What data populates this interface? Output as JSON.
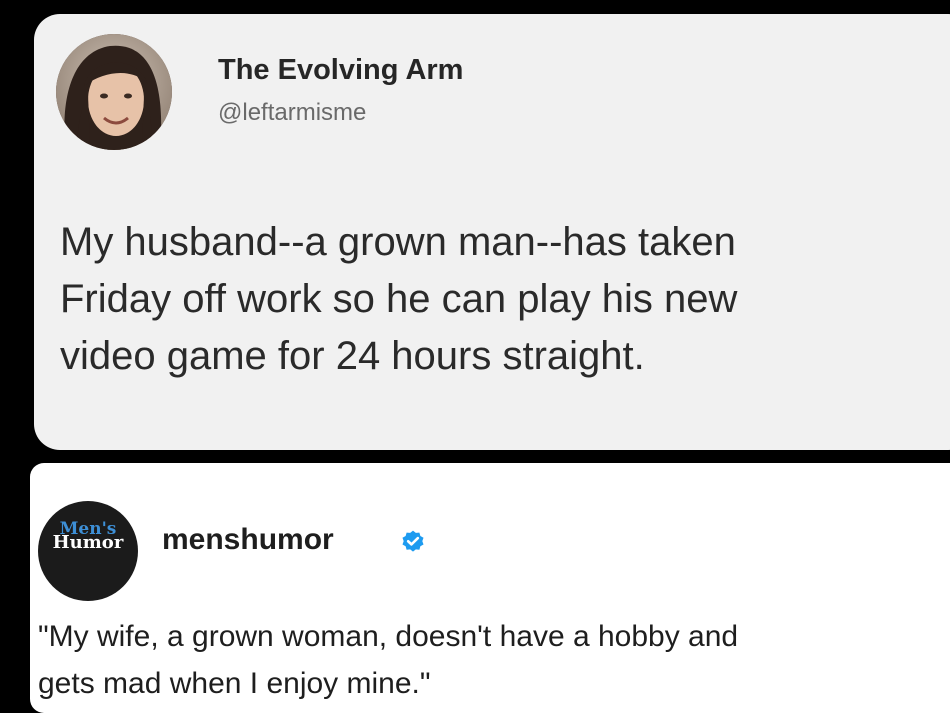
{
  "tweet": {
    "author_name": "The Evolving Arm",
    "author_handle": "@leftarmisme",
    "lines": [
      "My husband--a grown man--has taken",
      "Friday off work so he can play his new",
      "video game for 24 hours straight."
    ]
  },
  "quote": {
    "logo_top": "Men's",
    "logo_bottom": "Humor",
    "author_name": "menshumor",
    "verified_icon": "verified-badge-icon",
    "verified_color": "#1d9bf0",
    "more_icon": "more-options-icon",
    "lines": [
      "\"My wife, a grown woman, doesn't have a hobby and",
      "gets mad when I enjoy mine.\""
    ]
  },
  "colors": {
    "background": "#000000",
    "tweet_card": "#f1f1f1",
    "quote_card": "#ffffff",
    "logo_accent": "#3d8fd6"
  }
}
